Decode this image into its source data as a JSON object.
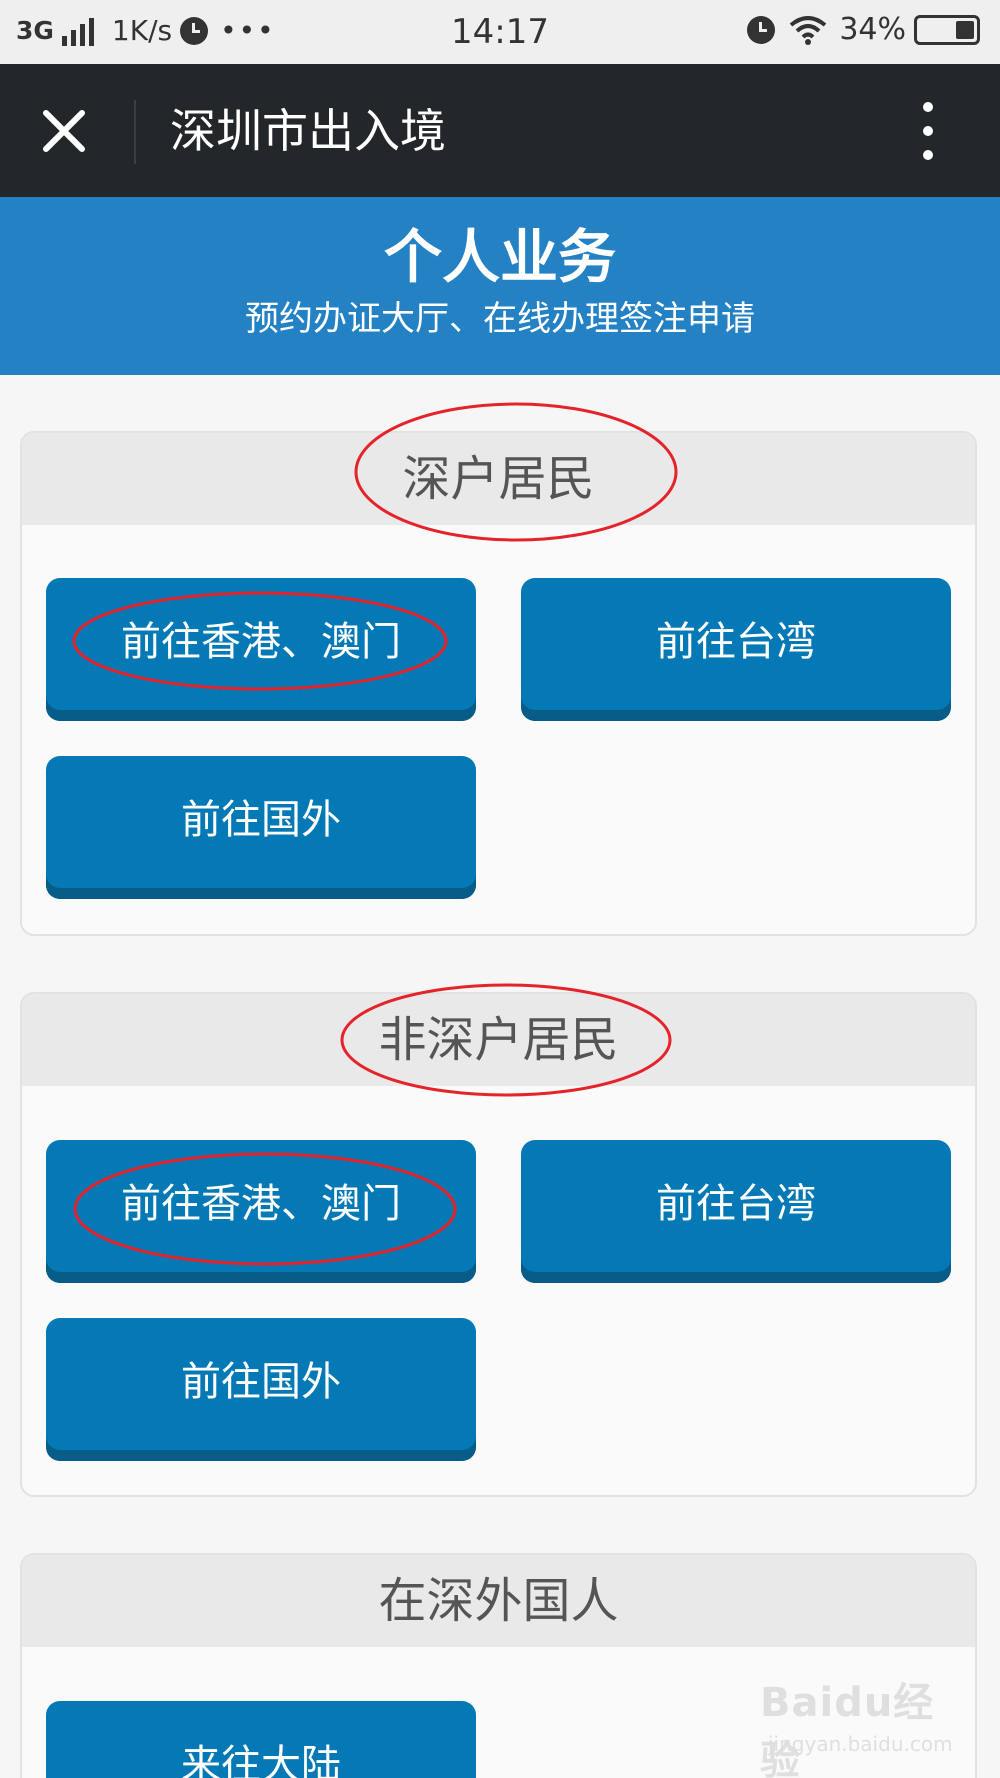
{
  "status_bar": {
    "network": "3G",
    "speed": "1K/s",
    "overflow": "•••",
    "time": "14:17",
    "battery": "34%",
    "battery_level": 0.34
  },
  "title_bar": {
    "title": "深圳市出入境",
    "close_icon": "close-icon",
    "more_icon": "more-vertical-icon"
  },
  "banner": {
    "title": "个人业务",
    "subtitle": "预约办证大厅、在线办理签注申请",
    "color": "#2381c4"
  },
  "sections": [
    {
      "title": "深户居民",
      "buttons": [
        {
          "label": "前往香港、澳门"
        },
        {
          "label": "前往台湾"
        },
        {
          "label": "前往国外"
        }
      ]
    },
    {
      "title": "非深户居民",
      "buttons": [
        {
          "label": "前往香港、澳门"
        },
        {
          "label": "前往台湾"
        },
        {
          "label": "前往国外"
        }
      ]
    },
    {
      "title": "在深外国人",
      "buttons": [
        {
          "label": "来往大陆"
        }
      ]
    }
  ],
  "watermark": {
    "logo": "Baidu经验",
    "url": "jingyan.baidu.com"
  },
  "colors": {
    "button": "#0579b5",
    "button_shadow": "#075c88",
    "annotation": "#e5232b"
  }
}
